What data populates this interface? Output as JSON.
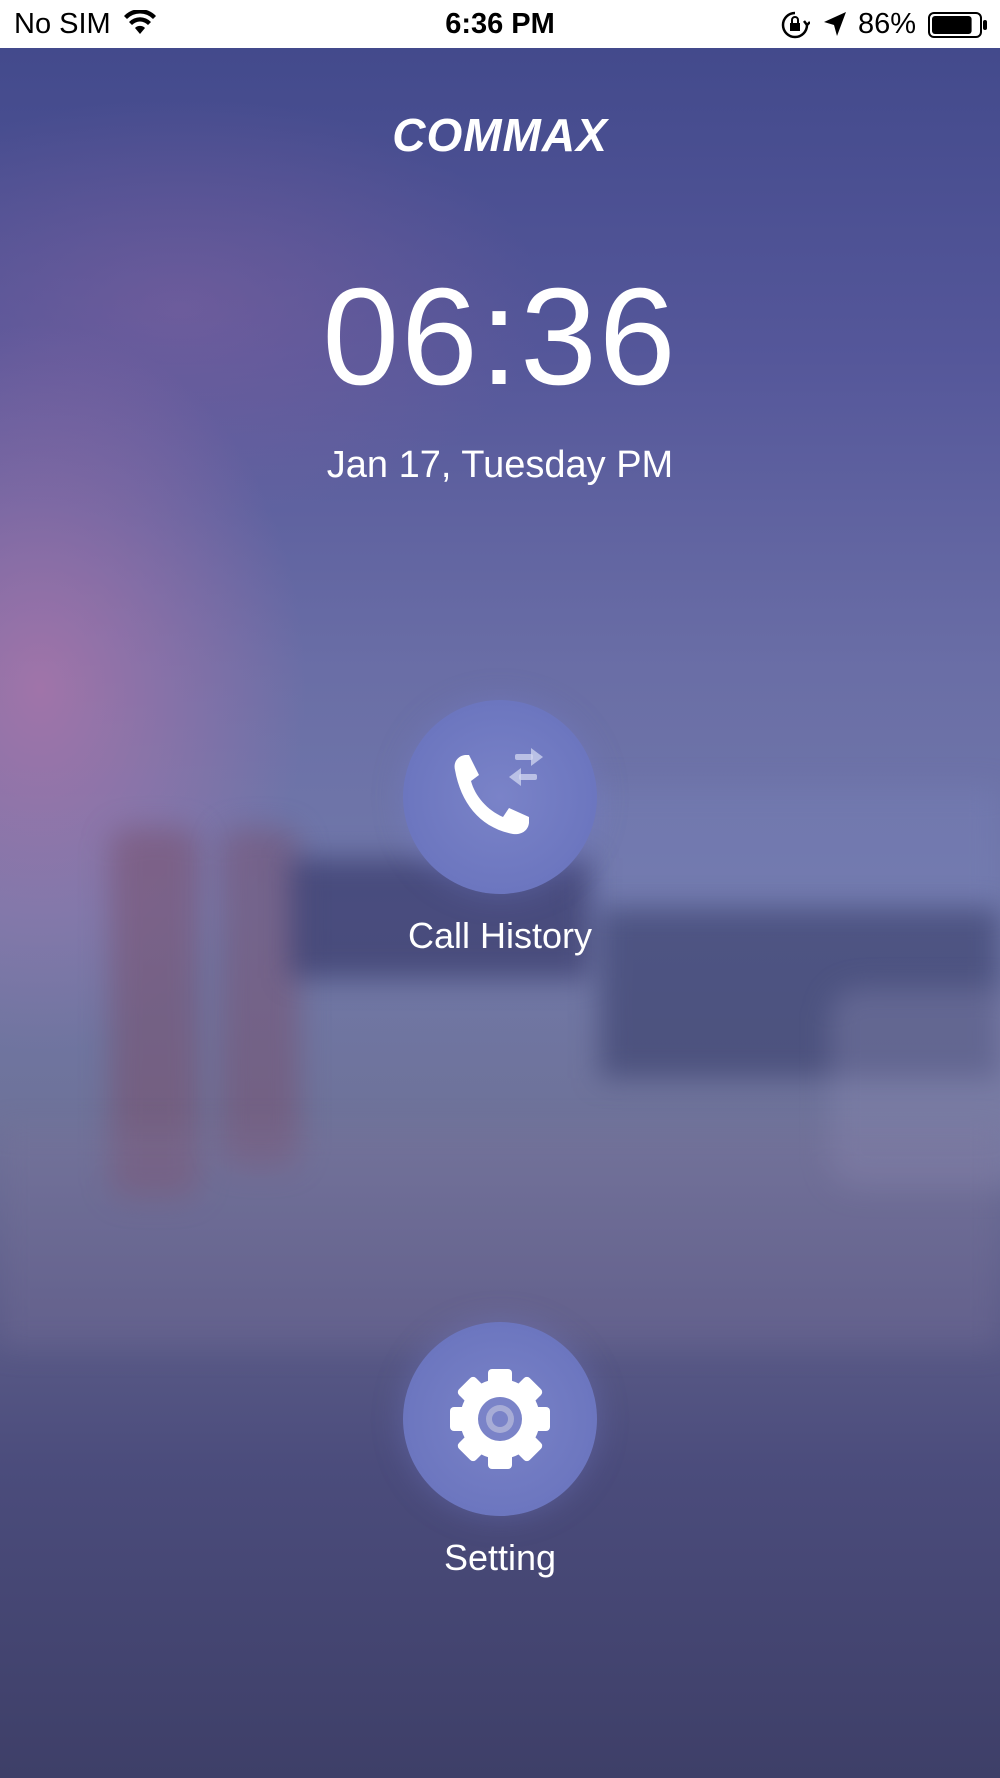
{
  "status_bar": {
    "carrier": "No SIM",
    "time": "6:36 PM",
    "battery_percent": "86%",
    "battery_level": 0.86,
    "icons": [
      "wifi-icon",
      "orientation-lock-icon",
      "location-arrow-icon",
      "battery-icon"
    ]
  },
  "app": {
    "logo": "COMMAX",
    "clock": "06:36",
    "date": "Jan 17, Tuesday PM"
  },
  "actions": {
    "call_history": {
      "label": "Call History",
      "icon": "phone-arrows-icon"
    },
    "setting": {
      "label": "Setting",
      "icon": "gear-icon"
    }
  },
  "colors": {
    "button_fill": "#6c76bf",
    "text": "#ffffff",
    "bg_top": "#434a8c",
    "bg_bottom": "#3e3f68"
  }
}
